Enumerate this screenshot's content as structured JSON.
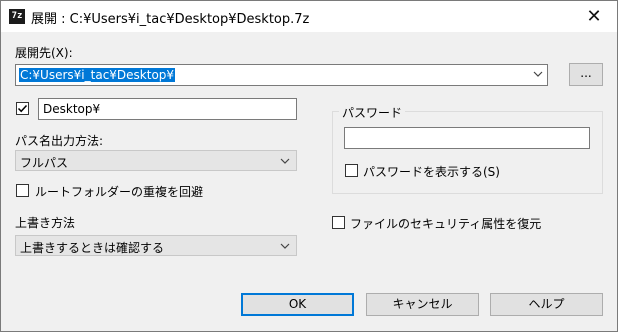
{
  "window": {
    "title": "展開 : C:¥Users¥i_tac¥Desktop¥Desktop.7z",
    "app_icon_text": "7z",
    "close_glyph": "✕"
  },
  "destination": {
    "label": "展開先(X):",
    "value": "C:¥Users¥i_tac¥Desktop¥",
    "browse_label": "..."
  },
  "subfolder": {
    "checked": true,
    "value": "Desktop¥"
  },
  "path_mode": {
    "label": "パス名出力方法:",
    "selected": "フルパス"
  },
  "root_folder": {
    "label": "ルートフォルダーの重複を回避",
    "checked": false
  },
  "overwrite": {
    "label": "上書き方法",
    "selected": "上書きするときは確認する"
  },
  "password": {
    "group_label": "パスワード",
    "value": "",
    "show_label": "パスワードを表示する(S)",
    "show_checked": false
  },
  "security": {
    "label": "ファイルのセキュリティ属性を復元",
    "checked": false
  },
  "buttons": {
    "ok": "OK",
    "cancel": "キャンセル",
    "help": "ヘルプ"
  }
}
